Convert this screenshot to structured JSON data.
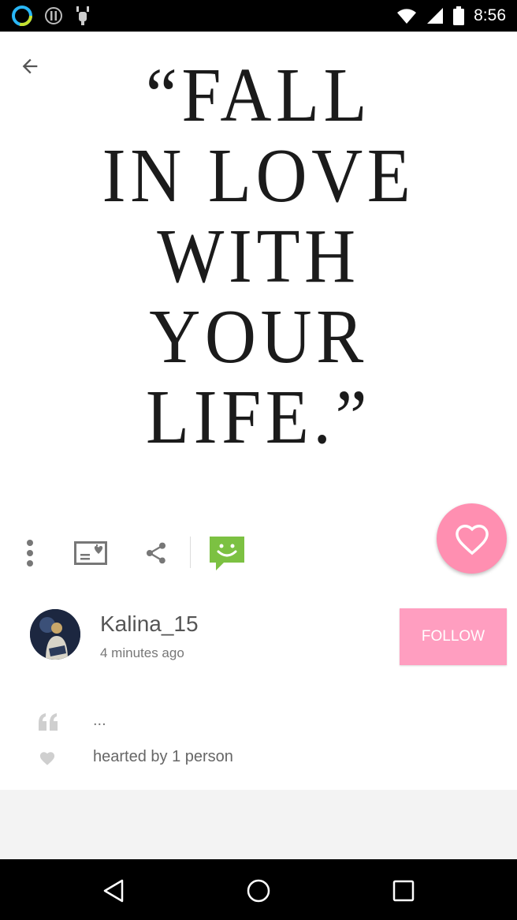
{
  "status_bar": {
    "time": "8:56",
    "icons": [
      "circle-app-icon",
      "info-icon",
      "android-debug-icon",
      "wifi-icon",
      "signal-icon",
      "battery-icon"
    ]
  },
  "post": {
    "quote_lines": [
      "“FALL",
      "IN LOVE",
      "WITH",
      "YOUR",
      "LIFE.”"
    ],
    "author": "Kalina_15",
    "time_ago": "4 minutes ago",
    "follow_label": "FOLLOW",
    "caption": "...",
    "hearts_text": "hearted by 1 person"
  },
  "actions": {
    "icons": [
      "more-icon",
      "postcard-icon",
      "share-icon",
      "sticker-chat-icon",
      "heart-icon"
    ]
  },
  "colors": {
    "accent_pink": "#ff9ec0",
    "heart_pink": "#ff8fb1",
    "sticker_green": "#7cc142"
  }
}
